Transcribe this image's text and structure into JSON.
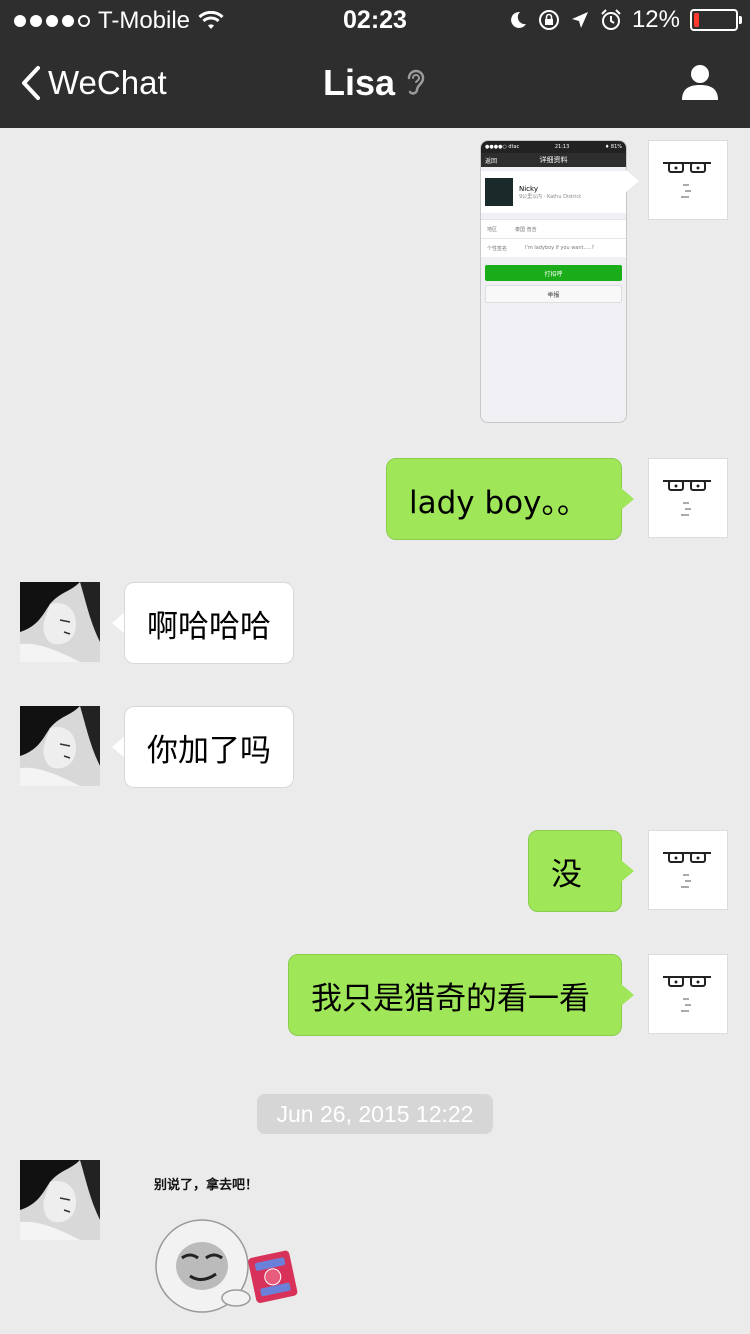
{
  "status_bar": {
    "carrier": "T-Mobile",
    "time": "02:23",
    "battery_percent": "12%",
    "battery_level": 0.12,
    "signal_bars_filled": 4,
    "signal_bars_total": 5
  },
  "nav": {
    "back_label": "WeChat",
    "title": "Lisa"
  },
  "screenshot_thumb": {
    "nav_back": "返回",
    "nav_title": "详细资料",
    "name": "Nicky",
    "distance": "9公里以内 · Kathu District",
    "region_label": "地区",
    "region_value": "泰国 普吉",
    "signature_label": "个性签名",
    "signature_value": "I'm ladyboy if you want.....?",
    "button_primary": "打招呼",
    "button_secondary": "举报"
  },
  "messages": [
    {
      "from": "me",
      "text": "lady boy。。"
    },
    {
      "from": "her",
      "text": "啊哈哈哈"
    },
    {
      "from": "her",
      "text": "你加了吗"
    },
    {
      "from": "me",
      "text": "没"
    },
    {
      "from": "me",
      "text": "我只是猎奇的看一看"
    }
  ],
  "timestamp": "Jun 26, 2015 12:22",
  "sticker": {
    "caption": "别说了，拿去吧！"
  },
  "colors": {
    "nav_bg": "#2e2e2f",
    "chat_bg": "#ebebeb",
    "my_bubble": "#9fe658",
    "her_bubble": "#ffffff",
    "battery_low": "#ff3b30"
  }
}
